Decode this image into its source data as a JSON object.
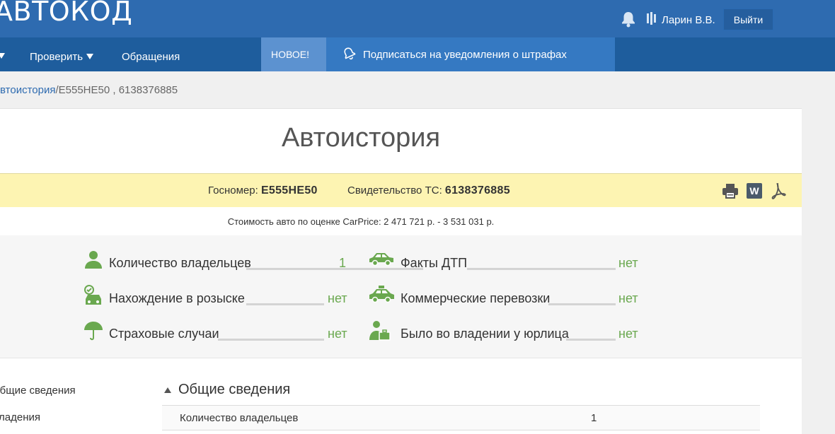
{
  "header": {
    "logo": "АВТОКОД",
    "user_name": "Ларин В.В.",
    "logout_label": "Выйти"
  },
  "nav": {
    "items": [
      {
        "label": "Проверить"
      },
      {
        "label": "Обращения"
      }
    ],
    "new_badge": "НОВОЕ!",
    "promo_label": "Подписаться на уведомления о штрафах"
  },
  "breadcrumb": {
    "link": "Автоистория",
    "separator": "/",
    "current": "Е555НЕ50 , 6138376885"
  },
  "page": {
    "title": "Автоистория"
  },
  "plate": {
    "gosnomer_label": "Госномер:",
    "gosnomer_value": "Е555НЕ50",
    "sts_label": "Свидетельство ТС:",
    "sts_value": "6138376885"
  },
  "price": {
    "text": "Стоимость авто по оценке CarPrice: 2 471 721 р. - 3 531 031 р."
  },
  "facts": [
    {
      "label": "Количество владельцев",
      "value": "1",
      "icon": "owner-icon"
    },
    {
      "label": "Факты ДТП",
      "value": "нет",
      "icon": "crash-car-icon"
    },
    {
      "label": "Нахождение в розыске",
      "value": "нет",
      "icon": "wanted-car-icon"
    },
    {
      "label": "Коммерческие перевозки",
      "value": "нет",
      "icon": "taxi-icon"
    },
    {
      "label": "Страховые случаи",
      "value": "нет",
      "icon": "umbrella-icon"
    },
    {
      "label": "Было во владении у юрлица",
      "value": "нет",
      "icon": "business-person-icon"
    }
  ],
  "sidebar": {
    "items": [
      {
        "label": "Общие сведения"
      },
      {
        "label": "Владения"
      }
    ]
  },
  "section": {
    "title": "Общие сведения",
    "rows": [
      {
        "key": "Количество владельцев",
        "value": "1"
      }
    ]
  },
  "colors": {
    "header_bg": "#2e6bb0",
    "nav_bg": "#1e5d9d",
    "accent_green": "#6aa84f",
    "plate_bg": "#fdf4b2"
  }
}
